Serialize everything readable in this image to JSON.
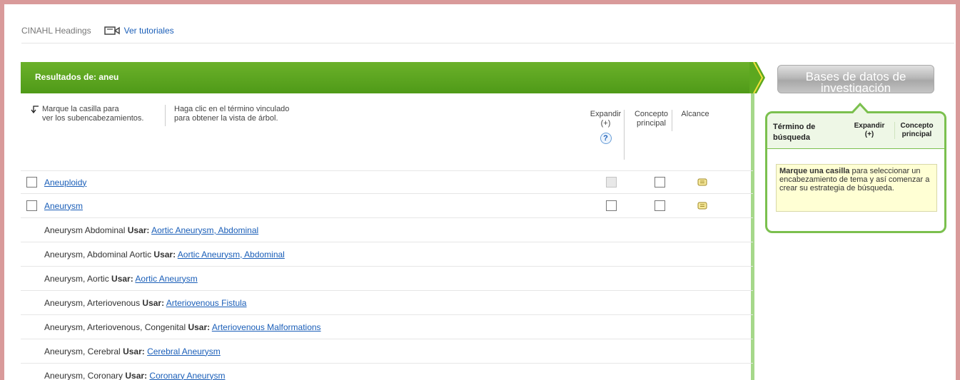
{
  "header": {
    "brand": "CINAHL Headings",
    "tutorials_label": "Ver tutoriales"
  },
  "results": {
    "title": "Resultados de: aneu",
    "instruction_1_line1": "Marque la casilla para",
    "instruction_1_line2": "ver los subencabezamientos.",
    "instruction_2_line1": "Haga clic en el término vinculado",
    "instruction_2_line2": "para obtener la vista de árbol.",
    "col_expand_line1": "Expandir",
    "col_expand_line2": "(+)",
    "col_major_line1": "Concepto",
    "col_major_line2": "principal",
    "col_scope": "Alcance",
    "help_glyph": "?",
    "terms": [
      {
        "label": "Aneuploidy",
        "expand_disabled": true
      },
      {
        "label": "Aneurysm",
        "expand_disabled": false
      }
    ],
    "see_refs": [
      {
        "entry": "Aneurysm Abdominal",
        "use": "Usar:",
        "target": "Aortic Aneurysm, Abdominal"
      },
      {
        "entry": "Aneurysm, Abdominal Aortic",
        "use": "Usar:",
        "target": "Aortic Aneurysm, Abdominal"
      },
      {
        "entry": "Aneurysm, Aortic",
        "use": "Usar:",
        "target": "Aortic Aneurysm"
      },
      {
        "entry": "Aneurysm, Arteriovenous",
        "use": "Usar:",
        "target": "Arteriovenous Fistula"
      },
      {
        "entry": "Aneurysm, Arteriovenous, Congenital",
        "use": "Usar:",
        "target": "Arteriovenous Malformations"
      },
      {
        "entry": "Aneurysm, Cerebral",
        "use": "Usar:",
        "target": "Cerebral Aneurysm"
      },
      {
        "entry": "Aneurysm, Coronary",
        "use": "Usar:",
        "target": "Coronary Aneurysm"
      }
    ]
  },
  "sidebar": {
    "db_button_line1": "Bases de datos de",
    "db_button_line2": "investigación",
    "col_term_line1": "Término de",
    "col_term_line2": "búsqueda",
    "col_expand_line1": "Expandir",
    "col_expand_line2": "(+)",
    "col_major_line1": "Concepto",
    "col_major_line2": "principal",
    "tip_bold": "Marque una casilla",
    "tip_rest": " para seleccionar un encabezamiento de tema y así comenzar a crear su estrategia de búsqueda."
  },
  "colors": {
    "green_header": "#5ca81f",
    "link": "#1a5eb8",
    "frame": "#d99a9a",
    "panel_border": "#7bc04e",
    "tip_bg": "#ffffd4"
  },
  "icons": {
    "tutorial": "video-icon",
    "arrow": "down-arrow-icon",
    "scope": "note-icon",
    "help": "help-icon"
  }
}
